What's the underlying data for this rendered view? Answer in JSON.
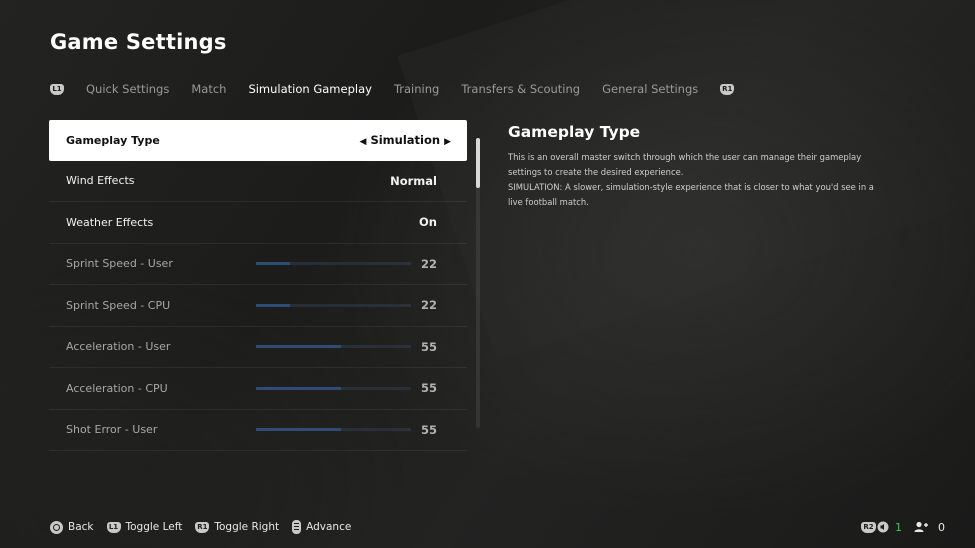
{
  "header": {
    "title": "Game Settings"
  },
  "tabs": {
    "left_bumper": "L1",
    "right_bumper": "R1",
    "items": [
      {
        "label": "Quick Settings"
      },
      {
        "label": "Match"
      },
      {
        "label": "Simulation Gameplay"
      },
      {
        "label": "Training"
      },
      {
        "label": "Transfers & Scouting"
      },
      {
        "label": "General Settings"
      }
    ],
    "active_index": 2
  },
  "settings": {
    "rows": [
      {
        "label": "Gameplay Type",
        "value": "Simulation",
        "arrow_left": "◀",
        "arrow_right": "▶"
      },
      {
        "label": "Wind Effects",
        "value": "Normal"
      },
      {
        "label": "Weather Effects",
        "value": "On"
      },
      {
        "label": "Sprint Speed - User",
        "value": "22",
        "slider_percent": 22
      },
      {
        "label": "Sprint Speed - CPU",
        "value": "22",
        "slider_percent": 22
      },
      {
        "label": "Acceleration - User",
        "value": "55",
        "slider_percent": 55
      },
      {
        "label": "Acceleration - CPU",
        "value": "55",
        "slider_percent": 55
      },
      {
        "label": "Shot Error - User",
        "value": "55",
        "slider_percent": 55
      }
    ],
    "selected_index": 0
  },
  "description": {
    "title": "Gameplay Type",
    "lines": [
      "This is an overall master switch through which the user can manage their gameplay",
      "settings to create the desired experience.",
      "SIMULATION: A slower, simulation-style experience that is closer to what you'd see in a",
      "live football match."
    ]
  },
  "footer": {
    "back_label": "Back",
    "toggle_left_badge": "L1",
    "toggle_left_label": "Toggle Left",
    "toggle_right_badge": "R1",
    "toggle_right_label": "Toggle Right",
    "advance_label": "Advance"
  },
  "status": {
    "r2_badge": "R2",
    "voice_count": "1",
    "party_count": "0",
    "voice_color": "#3ec45a"
  },
  "colors": {
    "background": "#1f1f1e",
    "selected_row": "#ffffff",
    "slider_fill": "#2f4d74"
  }
}
